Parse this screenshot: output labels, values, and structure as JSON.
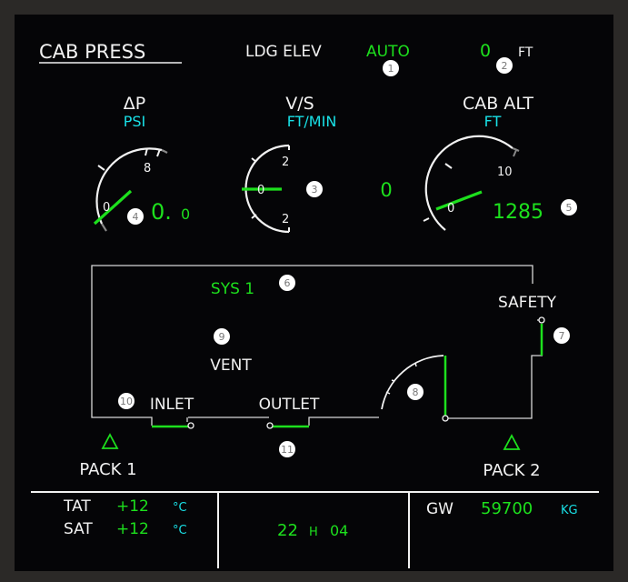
{
  "title": "CAB PRESS",
  "ldg_elev": {
    "label": "LDG ELEV",
    "mode": "AUTO",
    "value": "0",
    "unit": "FT"
  },
  "delta_p": {
    "label": "ΔP",
    "unit": "PSI",
    "tick_0": "0",
    "tick_8": "8",
    "value_int": "0.",
    "value_dec": "0"
  },
  "vs": {
    "label": "V/S",
    "unit": "FT/MIN",
    "tick_top": "2",
    "tick_mid": "0",
    "tick_bot": "2",
    "value": "0"
  },
  "cab_alt": {
    "label": "CAB ALT",
    "unit": "FT",
    "tick_0": "0",
    "tick_10": "10",
    "value": "1285"
  },
  "system": "SYS 1",
  "safety": "SAFETY",
  "vent": "VENT",
  "inlet": "INLET",
  "outlet": "OUTLET",
  "pack1": "PACK 1",
  "pack2": "PACK 2",
  "footer": {
    "tat_label": "TAT",
    "tat_value": "+12",
    "sat_label": "SAT",
    "sat_value": "+12",
    "temp_unit": "°C",
    "time_h": "22",
    "time_sep": "H",
    "time_m": "04",
    "gw_label": "GW",
    "gw_value": "59700",
    "gw_unit": "KG"
  },
  "annotations": [
    "1",
    "2",
    "3",
    "4",
    "5",
    "6",
    "7",
    "8",
    "9",
    "10",
    "11"
  ],
  "colors": {
    "green": "#1de01d",
    "cyan": "#19e0e6",
    "white": "#f2f2f2",
    "background": "#050507"
  }
}
